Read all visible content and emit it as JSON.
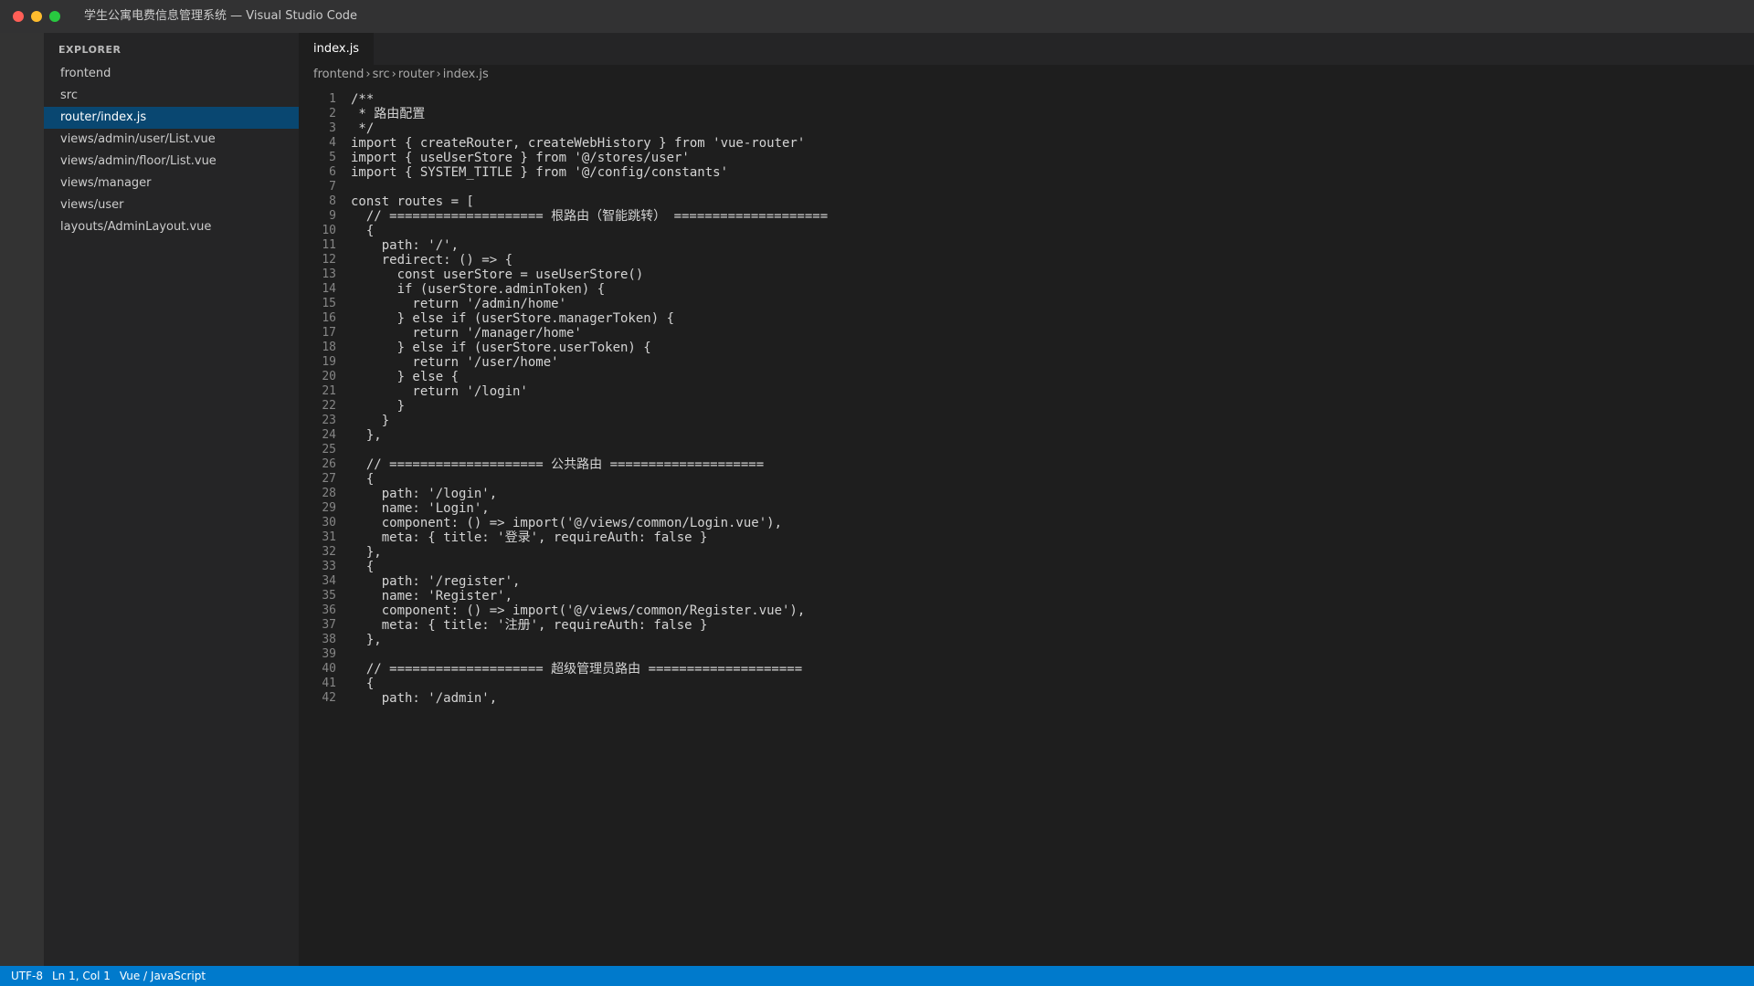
{
  "window": {
    "title": "学生公寓电费信息管理系统 — Visual Studio Code"
  },
  "sidebar": {
    "title": "EXPLORER",
    "items": [
      {
        "label": "frontend",
        "selected": false
      },
      {
        "label": "src",
        "selected": false
      },
      {
        "label": "router/index.js",
        "selected": true
      },
      {
        "label": "views/admin/user/List.vue",
        "selected": false
      },
      {
        "label": "views/admin/floor/List.vue",
        "selected": false
      },
      {
        "label": "views/manager",
        "selected": false
      },
      {
        "label": "views/user",
        "selected": false
      },
      {
        "label": "layouts/AdminLayout.vue",
        "selected": false
      }
    ]
  },
  "editor": {
    "tab": "index.js",
    "breadcrumb": [
      "frontend",
      "src",
      "router",
      "index.js"
    ],
    "lines": [
      "/**",
      " * 路由配置",
      " */",
      "import { createRouter, createWebHistory } from 'vue-router'",
      "import { useUserStore } from '@/stores/user'",
      "import { SYSTEM_TITLE } from '@/config/constants'",
      "",
      "const routes = [",
      "  // ==================== 根路由（智能跳转） ====================",
      "  {",
      "    path: '/',",
      "    redirect: () => {",
      "      const userStore = useUserStore()",
      "      if (userStore.adminToken) {",
      "        return '/admin/home'",
      "      } else if (userStore.managerToken) {",
      "        return '/manager/home'",
      "      } else if (userStore.userToken) {",
      "        return '/user/home'",
      "      } else {",
      "        return '/login'",
      "      }",
      "    }",
      "  },",
      "",
      "  // ==================== 公共路由 ====================",
      "  {",
      "    path: '/login',",
      "    name: 'Login',",
      "    component: () => import('@/views/common/Login.vue'),",
      "    meta: { title: '登录', requireAuth: false }",
      "  },",
      "  {",
      "    path: '/register',",
      "    name: 'Register',",
      "    component: () => import('@/views/common/Register.vue'),",
      "    meta: { title: '注册', requireAuth: false }",
      "  },",
      "",
      "  // ==================== 超级管理员路由 ====================",
      "  {",
      "    path: '/admin',"
    ]
  },
  "statusbar": {
    "items": [
      "UTF-8",
      "Ln 1, Col 1",
      "Vue / JavaScript"
    ]
  },
  "colors": {
    "titlebar": "#323233",
    "activitybar": "#333333",
    "sidebar": "#252526",
    "editor": "#1e1e1e",
    "selection": "#094771",
    "statusbar": "#007acc"
  }
}
